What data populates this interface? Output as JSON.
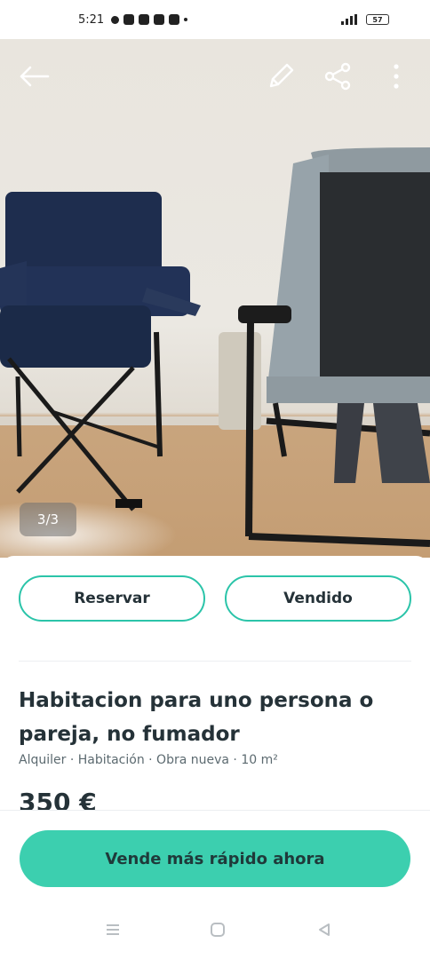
{
  "status_bar": {
    "time": "5:21",
    "battery": "57"
  },
  "photo": {
    "counter": "3/3"
  },
  "actions": {
    "reserve_label": "Reservar",
    "sold_label": "Vendido"
  },
  "listing": {
    "title": "Habitacion para uno persona o pareja, no fumador",
    "meta": "Alquiler · Habitación · Obra nueva · 10 m²",
    "price": "350 €"
  },
  "cta": {
    "label": "Vende más rápido ahora"
  },
  "colors": {
    "accent": "#2bc4a9",
    "cta_bg": "#3ccfaf",
    "text": "#253238"
  },
  "icons": [
    "back-arrow-icon",
    "edit-pencil-icon",
    "share-icon",
    "more-vertical-icon",
    "menu-icon",
    "home-icon",
    "back-icon"
  ]
}
